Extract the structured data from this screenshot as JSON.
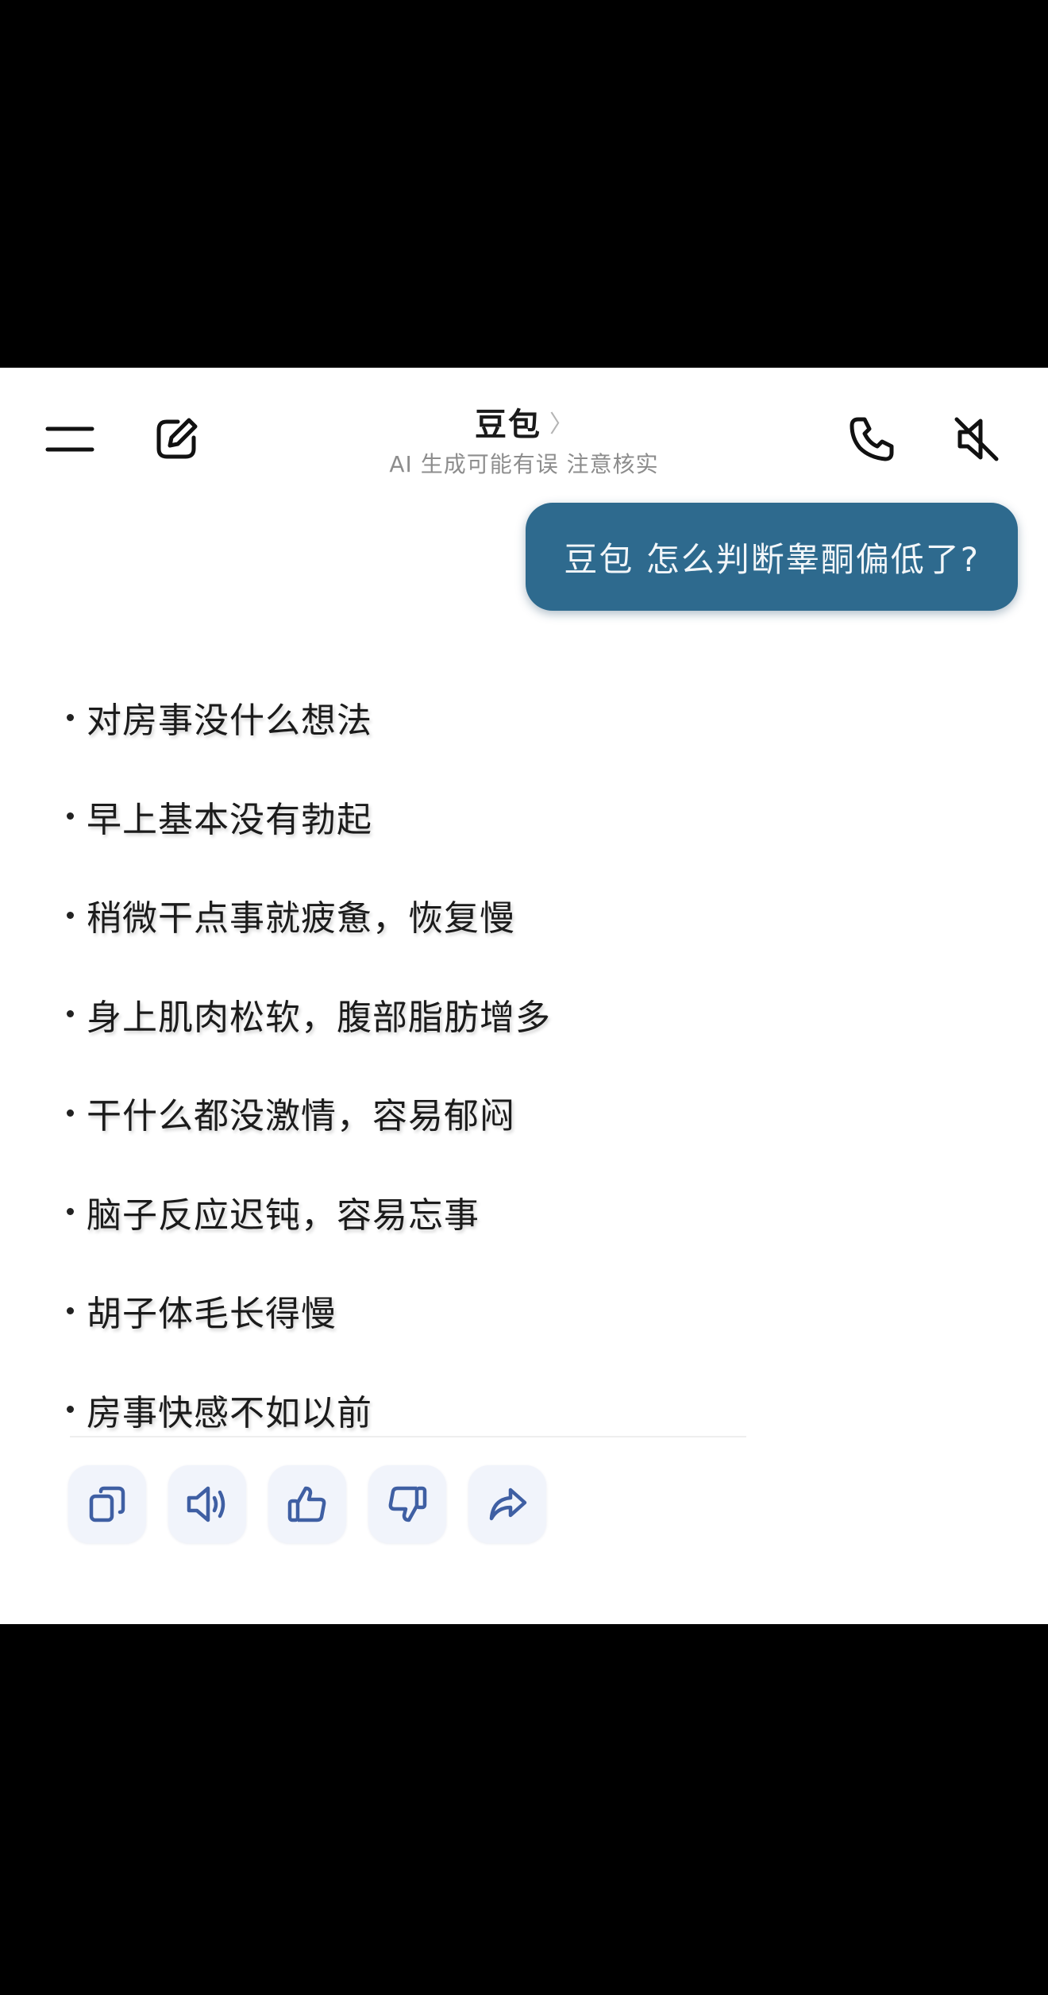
{
  "header": {
    "title": "豆包",
    "title_chevron": "〉",
    "subtitle": "AI 生成可能有误 注意核实",
    "icons": {
      "menu": "menu-icon",
      "edit": "edit-icon",
      "call": "phone-icon",
      "mute": "speaker-muted-icon"
    }
  },
  "chat": {
    "user_message": "豆包 怎么判断睾酮偏低了?",
    "symptoms": [
      "对房事没什么想法",
      "早上基本没有勃起",
      "稍微干点事就疲惫，恢复慢",
      "身上肌肉松软，腹部脂肪增多",
      "干什么都没激情，容易郁闷",
      "脑子反应迟钝，容易忘事",
      "胡子体毛长得慢",
      "房事快感不如以前"
    ]
  },
  "actions": {
    "icons": [
      "copy-icon",
      "speaker-icon",
      "thumbs-up-icon",
      "thumbs-down-icon",
      "share-icon"
    ]
  },
  "colors": {
    "bubble": "#2e6a8e",
    "bubble_text": "#f2f6f9",
    "action_icon": "#3f5fa3",
    "action_bg": "#f1f4fb",
    "frame": "#000000"
  }
}
